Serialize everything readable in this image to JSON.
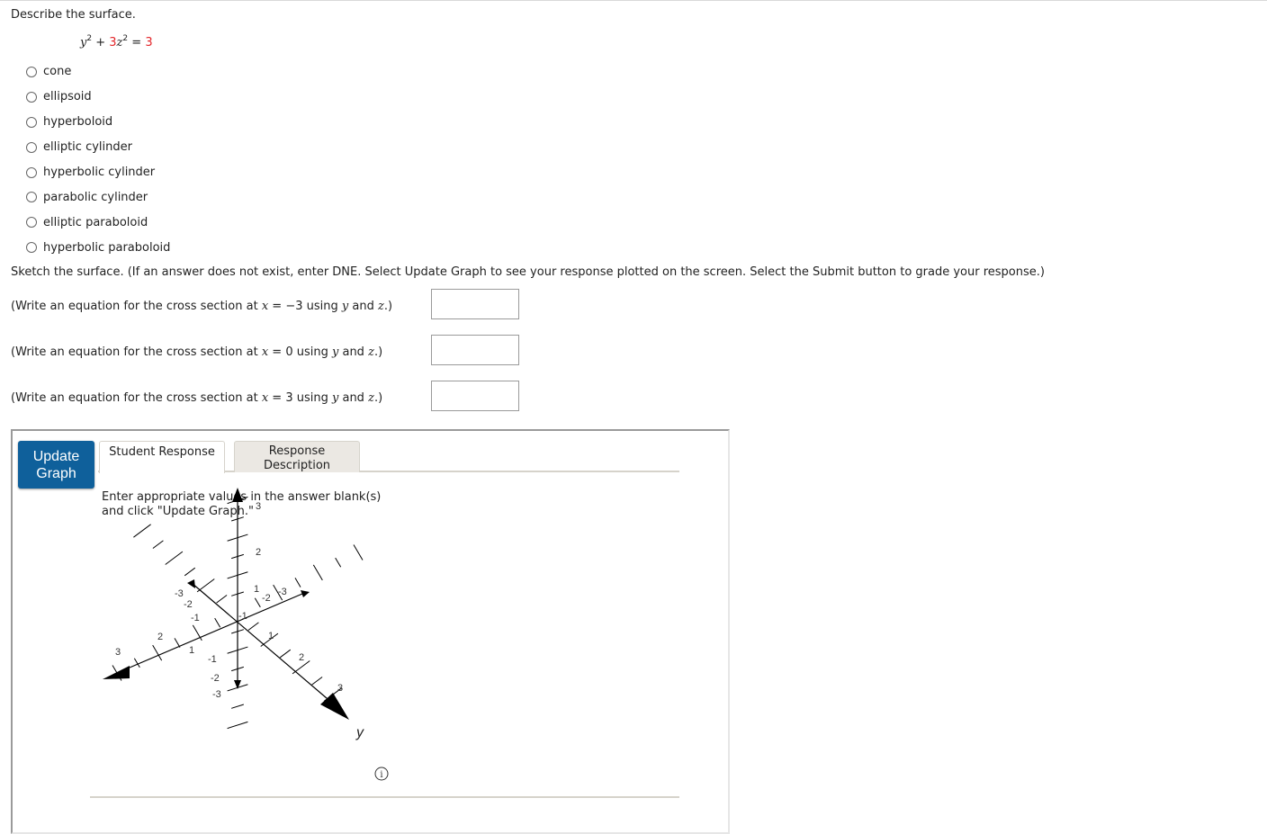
{
  "question": {
    "prompt": "Describe the surface.",
    "equation": {
      "y_term": "y",
      "y_exp": "2",
      "plus": " + ",
      "coef": "3",
      "z_term": "z",
      "z_exp": "2",
      "equals": " = ",
      "rhs": "3"
    },
    "options": [
      {
        "label": "cone",
        "selected": false
      },
      {
        "label": "ellipsoid",
        "selected": false
      },
      {
        "label": "hyperboloid",
        "selected": false
      },
      {
        "label": "elliptic cylinder",
        "selected": false
      },
      {
        "label": "hyperbolic cylinder",
        "selected": false
      },
      {
        "label": "parabolic cylinder",
        "selected": false
      },
      {
        "label": "elliptic paraboloid",
        "selected": false
      },
      {
        "label": "hyperbolic paraboloid",
        "selected": false
      }
    ]
  },
  "sketch": {
    "instruction": "Sketch the surface. (If an answer does not exist, enter DNE. Select Update Graph to see your response plotted on the screen. Select the Submit button to grade your response.)",
    "cross_sections": [
      {
        "pre": "(Write an equation for the cross section at ",
        "var": "x",
        "eq": " = −3 using ",
        "v1": "y",
        "and": " and ",
        "v2": "z",
        "post": ".)",
        "value": ""
      },
      {
        "pre": "(Write an equation for the cross section at ",
        "var": "x",
        "eq": " = 0 using ",
        "v1": "y",
        "and": " and ",
        "v2": "z",
        "post": ".)",
        "value": ""
      },
      {
        "pre": "(Write an equation for the cross section at ",
        "var": "x",
        "eq": " = 3 using ",
        "v1": "y",
        "and": " and ",
        "v2": "z",
        "post": ".)",
        "value": ""
      }
    ]
  },
  "graph_panel": {
    "update_button": {
      "line1": "Update",
      "line2": "Graph",
      "color": "#0f609b"
    },
    "tabs": [
      {
        "label": "Student Response",
        "active": true
      },
      {
        "label_line1": "Response",
        "label_line2": "Description",
        "active": false
      }
    ],
    "message_line1": "Enter appropriate values in the answer blank(s)",
    "message_line2": "and click \"Update Graph.\"",
    "axes": {
      "z_ticks": [
        "3",
        "2",
        "1",
        "-1",
        "-2",
        "-3"
      ],
      "y_ticks": [
        "1",
        "2",
        "3",
        "-1",
        "-2",
        "-3"
      ],
      "x_ticks": [
        "1",
        "2",
        "3",
        "-1",
        "-2",
        "-3"
      ],
      "y_label": "y"
    },
    "info_icon": "info-icon"
  }
}
